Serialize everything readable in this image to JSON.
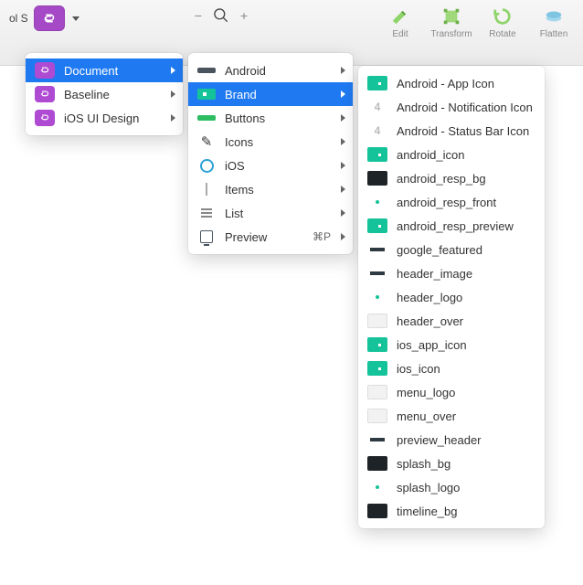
{
  "toolbar": {
    "left_fragment": "ol  S",
    "tools": [
      {
        "label": "Edit"
      },
      {
        "label": "Transform"
      },
      {
        "label": "Rotate"
      },
      {
        "label": "Flatten"
      }
    ]
  },
  "menu1": {
    "items": [
      {
        "label": "Document",
        "selected": true
      },
      {
        "label": "Baseline",
        "selected": false
      },
      {
        "label": "iOS UI Design",
        "selected": false
      }
    ]
  },
  "menu2": {
    "items": [
      {
        "label": "Android",
        "icon": "swatch-line",
        "submenu": true
      },
      {
        "label": "Brand",
        "icon": "swatch-teal",
        "selected": true,
        "submenu": true
      },
      {
        "label": "Buttons",
        "icon": "swatch-green",
        "submenu": true
      },
      {
        "label": "Icons",
        "icon": "pencil",
        "submenu": true
      },
      {
        "label": "iOS",
        "icon": "circle-o",
        "submenu": true
      },
      {
        "label": "Items",
        "icon": "line-v",
        "submenu": true
      },
      {
        "label": "List",
        "icon": "list-ic",
        "submenu": true
      },
      {
        "label": "Preview",
        "icon": "device-ic",
        "shortcut": "⌘P",
        "submenu": true
      }
    ]
  },
  "menu3": {
    "items": [
      {
        "label": "Android - App Icon",
        "thumb": "teal"
      },
      {
        "label": "Android - Notification Icon",
        "thumb": "circle4",
        "glyph": "4"
      },
      {
        "label": "Android - Status Bar Icon",
        "thumb": "circle4",
        "glyph": "4"
      },
      {
        "label": "android_icon",
        "thumb": "teal"
      },
      {
        "label": "android_resp_bg",
        "thumb": "dark"
      },
      {
        "label": "android_resp_front",
        "thumb": "dot"
      },
      {
        "label": "android_resp_preview",
        "thumb": "teal"
      },
      {
        "label": "google_featured",
        "thumb": "bar"
      },
      {
        "label": "header_image",
        "thumb": "bar"
      },
      {
        "label": "header_logo",
        "thumb": "dot"
      },
      {
        "label": "header_over",
        "thumb": "white"
      },
      {
        "label": "ios_app_icon",
        "thumb": "teal"
      },
      {
        "label": "ios_icon",
        "thumb": "teal"
      },
      {
        "label": "menu_logo",
        "thumb": "white"
      },
      {
        "label": "menu_over",
        "thumb": "white"
      },
      {
        "label": "preview_header",
        "thumb": "bar"
      },
      {
        "label": "splash_bg",
        "thumb": "dark"
      },
      {
        "label": "splash_logo",
        "thumb": "dot"
      },
      {
        "label": "timeline_bg",
        "thumb": "dark"
      }
    ]
  }
}
